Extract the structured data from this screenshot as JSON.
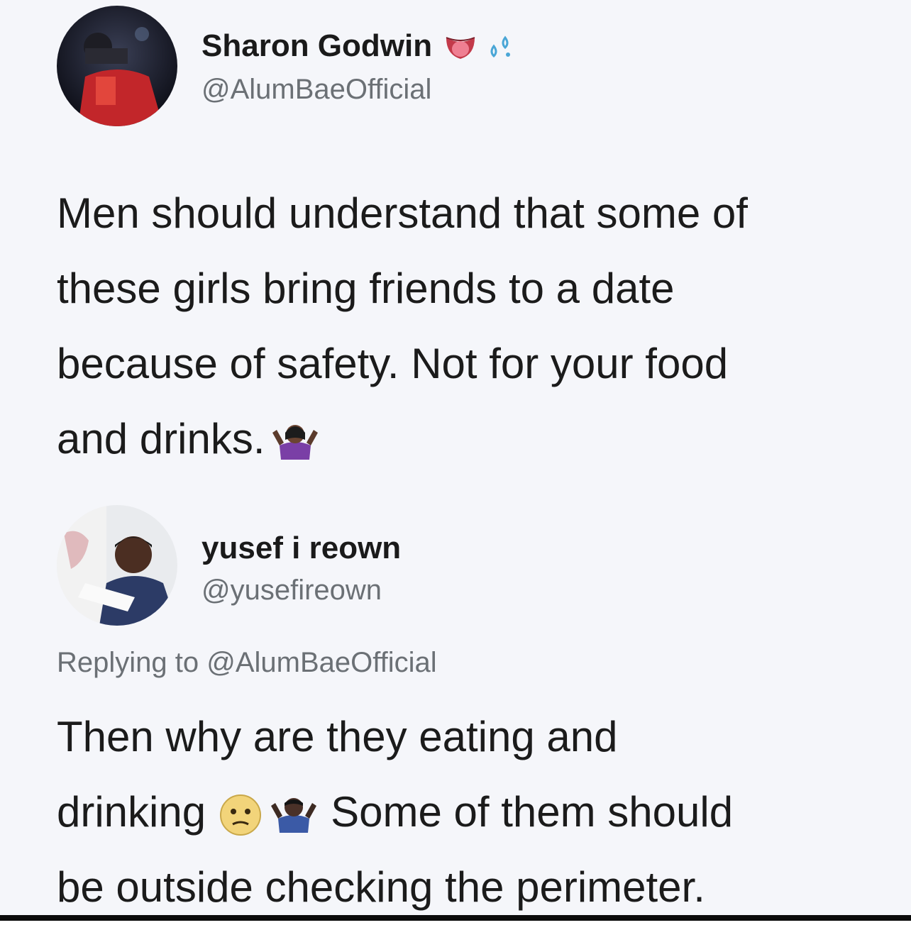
{
  "tweet": {
    "author_name": "Sharon Godwin",
    "author_handle": "@AlumBaeOfficial",
    "name_emojis": [
      "tongue-mouth-icon",
      "sweat-droplets-icon"
    ],
    "text_lines": [
      "Men should understand that some of",
      "these girls bring friends to a date",
      "because of safety. Not for your food",
      "and drinks."
    ],
    "trailing_emoji": "woman-shrugging-icon"
  },
  "reply": {
    "author_name": "yusef i reown",
    "author_handle": "@yusefireown",
    "replying_prefix": "Replying to",
    "replying_to": "@AlumBaeOfficial",
    "text_line_1": "Then why are they eating and",
    "text_line_2_start": "drinking",
    "text_line_2_end": "Some of them should",
    "text_line_3": "be outside checking the perimeter.",
    "emojis": [
      "confused-face-icon",
      "man-shrugging-icon"
    ]
  },
  "colors": {
    "background": "#f5f6fa",
    "text": "#1b1b1b",
    "secondary_text": "#6b7075"
  }
}
